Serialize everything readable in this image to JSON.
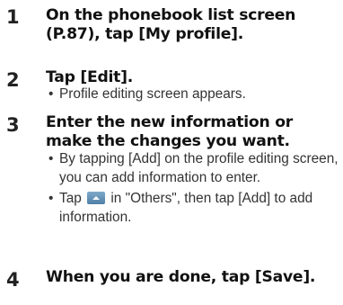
{
  "steps": [
    {
      "number": "1",
      "title": "On the phonebook list screen (P.87), tap [My profile].",
      "bullets": []
    },
    {
      "number": "2",
      "title": "Tap [Edit].",
      "bullets": [
        "Profile editing screen appears."
      ]
    },
    {
      "number": "3",
      "title": "Enter the new information or make the changes you want.",
      "bullets": [
        "By tapping [Add] on the profile editing screen, you can add information to enter.",
        {
          "before_icon": "Tap",
          "icon": "expand-arrow-icon",
          "after_icon": "in \"Others\", then tap [Add] to add information."
        }
      ]
    },
    {
      "number": "4",
      "title": "When you are done, tap [Save].",
      "bullets": []
    }
  ]
}
